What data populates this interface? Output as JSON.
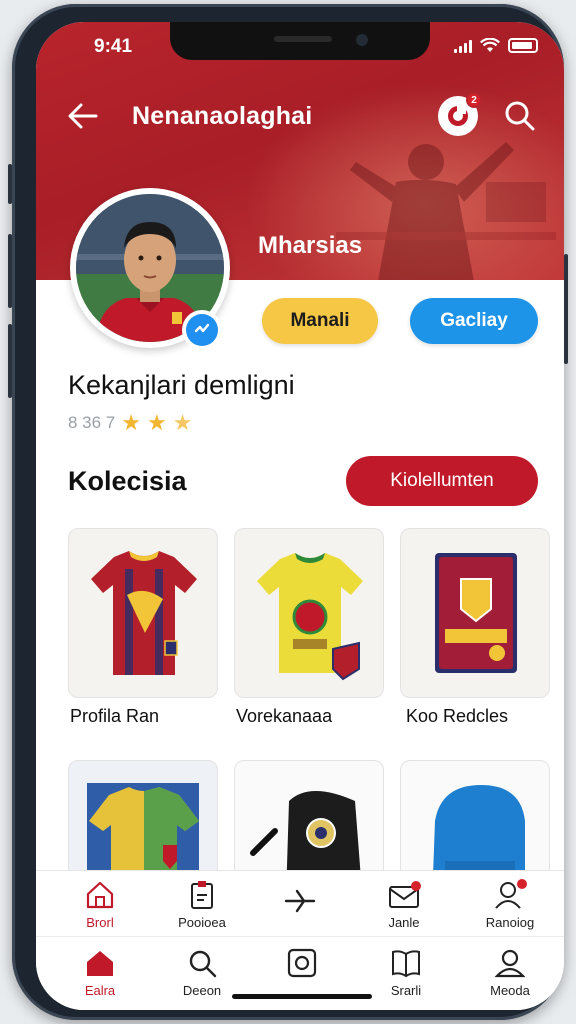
{
  "status": {
    "time": "9:41"
  },
  "header": {
    "title": "Nenanaolaghai",
    "notification_badge": "2"
  },
  "profile": {
    "name": "Mharsias",
    "follow_label": "Manali",
    "message_label": "Gacliay",
    "bio": "Kekanjlari demligni",
    "rating_prefix": "8 36 7"
  },
  "collection": {
    "heading": "Kolecisia",
    "see_all_label": "Kiolellumten",
    "items": [
      {
        "label": "Profila Ran"
      },
      {
        "label": "Vorekanaaa"
      },
      {
        "label": "Koo Redcles"
      },
      {
        "label": ""
      },
      {
        "label": ""
      },
      {
        "label": ""
      }
    ]
  },
  "tabbar_top": [
    {
      "label": "Brorl",
      "icon": "home-outline-icon"
    },
    {
      "label": "Pooioea",
      "icon": "clipboard-icon"
    },
    {
      "label": "",
      "icon": "play-icon"
    },
    {
      "label": "Janle",
      "icon": "mail-icon"
    },
    {
      "label": "Ranoiog",
      "icon": "profile-icon"
    }
  ],
  "tabbar_bottom": [
    {
      "label": "Ealra",
      "icon": "home-icon"
    },
    {
      "label": "Deeon",
      "icon": "search-icon"
    },
    {
      "label": "",
      "icon": "square-icon"
    },
    {
      "label": "Srarli",
      "icon": "book-icon"
    },
    {
      "label": "Meoda",
      "icon": "user-icon"
    }
  ],
  "colors": {
    "brand_red": "#b8242c",
    "accent_yellow": "#f6c744",
    "accent_blue": "#1e94e8",
    "button_red": "#c0192a"
  }
}
